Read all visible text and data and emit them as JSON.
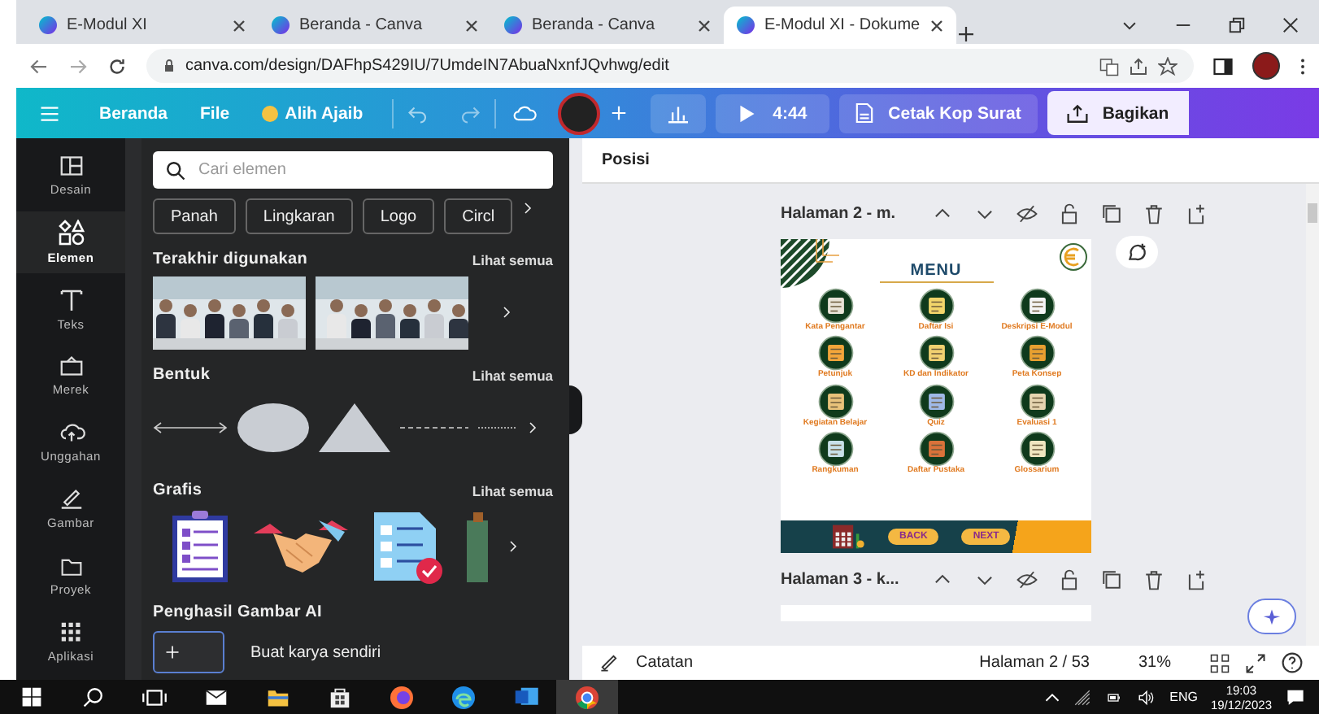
{
  "browser": {
    "tabs": [
      {
        "title": "E-Modul XI",
        "selected": false
      },
      {
        "title": "Beranda - Canva",
        "selected": false
      },
      {
        "title": "Beranda - Canva",
        "selected": false
      },
      {
        "title": "E-Modul XI - Dokume",
        "selected": true
      }
    ],
    "url": "canva.com/design/DAFhpS429IU/7UmdeIN7AbuaNxnfJQvhwg/edit"
  },
  "toolbar": {
    "home": "Beranda",
    "file": "File",
    "magic": "Alih Ajaib",
    "timer": "4:44",
    "print": "Cetak Kop Surat",
    "share": "Bagikan"
  },
  "rail": [
    {
      "kind": "design",
      "label": "Desain",
      "selected": false
    },
    {
      "kind": "elements",
      "label": "Elemen",
      "selected": true
    },
    {
      "kind": "text",
      "label": "Teks",
      "selected": false
    },
    {
      "kind": "brand",
      "label": "Merek",
      "selected": false
    },
    {
      "kind": "upload",
      "label": "Unggahan",
      "selected": false
    },
    {
      "kind": "draw",
      "label": "Gambar",
      "selected": false
    },
    {
      "kind": "folder",
      "label": "Proyek",
      "selected": false
    },
    {
      "kind": "apps",
      "label": "Aplikasi",
      "selected": false
    }
  ],
  "panel": {
    "search": {
      "placeholder": "Cari elemen"
    },
    "chips": [
      "Panah",
      "Lingkaran",
      "Logo",
      "Circl"
    ],
    "sections": [
      {
        "kind": "photos",
        "title": "Terakhir digunakan",
        "see_all": "Lihat semua"
      },
      {
        "kind": "shapes",
        "title": "Bentuk",
        "see_all": "Lihat semua"
      },
      {
        "kind": "graphics",
        "title": "Grafis",
        "see_all": "Lihat semua"
      },
      {
        "kind": "ai",
        "title": "Penghasil Gambar AI",
        "action": "Buat karya sendiri"
      }
    ]
  },
  "canvas": {
    "header": "Posisi",
    "pages": [
      {
        "title": "Halaman 2 - m.",
        "design": {
          "title": "MENU",
          "items": [
            "Kata Pengantar",
            "Daftar Isi",
            "Deskripsi E-Modul",
            "Petunjuk",
            "KD dan Indikator",
            "Peta Konsep",
            "Kegiatan Belajar",
            "Quiz",
            "Evaluasi 1",
            "Rangkuman",
            "Daftar Pustaka",
            "Glossarium"
          ],
          "buttons": [
            "BACK",
            "NEXT"
          ]
        }
      },
      {
        "title": "Halaman 3 - k..."
      }
    ]
  },
  "status": {
    "notes": "Catatan",
    "page": "Halaman 2 / 53",
    "zoom": "31%"
  },
  "taskbar": {
    "apps": [
      {
        "kind": "mail",
        "selected": false
      },
      {
        "kind": "folder",
        "selected": false
      },
      {
        "kind": "store",
        "selected": false
      },
      {
        "kind": "firefox",
        "selected": false
      },
      {
        "kind": "edge",
        "selected": false
      },
      {
        "kind": "word",
        "selected": false
      },
      {
        "kind": "chrome",
        "selected": true
      }
    ],
    "lang": "ENG",
    "time": "19:03",
    "date": "19/12/2023"
  }
}
